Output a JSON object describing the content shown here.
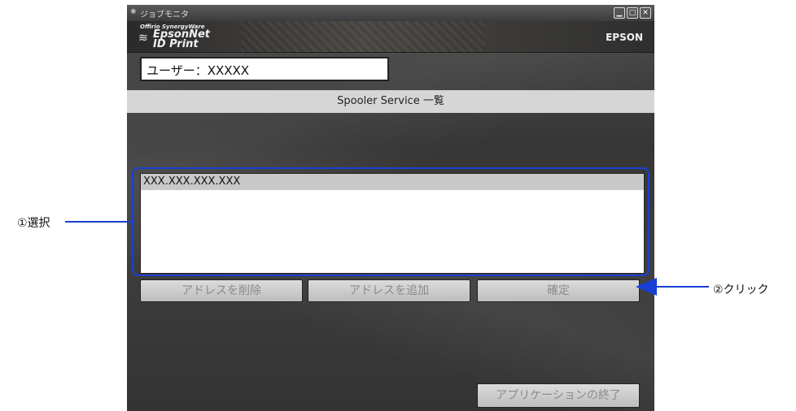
{
  "window": {
    "title": "ジョブモニタ",
    "brand_line": "Offirio SynergyWare",
    "brand_name_1": "EpsonNet",
    "brand_name_2": "ID Print",
    "vendor": "EPSON"
  },
  "user": {
    "label": "ユーザー：XXXXX"
  },
  "list": {
    "title": "Spooler Service 一覧",
    "items": [
      "XXX.XXX.XXX.XXX"
    ]
  },
  "buttons": {
    "delete_address": "アドレスを削除",
    "add_address": "アドレスを追加",
    "confirm": "確定",
    "exit_app": "アプリケーションの終了"
  },
  "annotations": {
    "step1": "①選択",
    "step2": "②クリック"
  },
  "colors": {
    "annotation_blue": "#1a3fd6"
  }
}
